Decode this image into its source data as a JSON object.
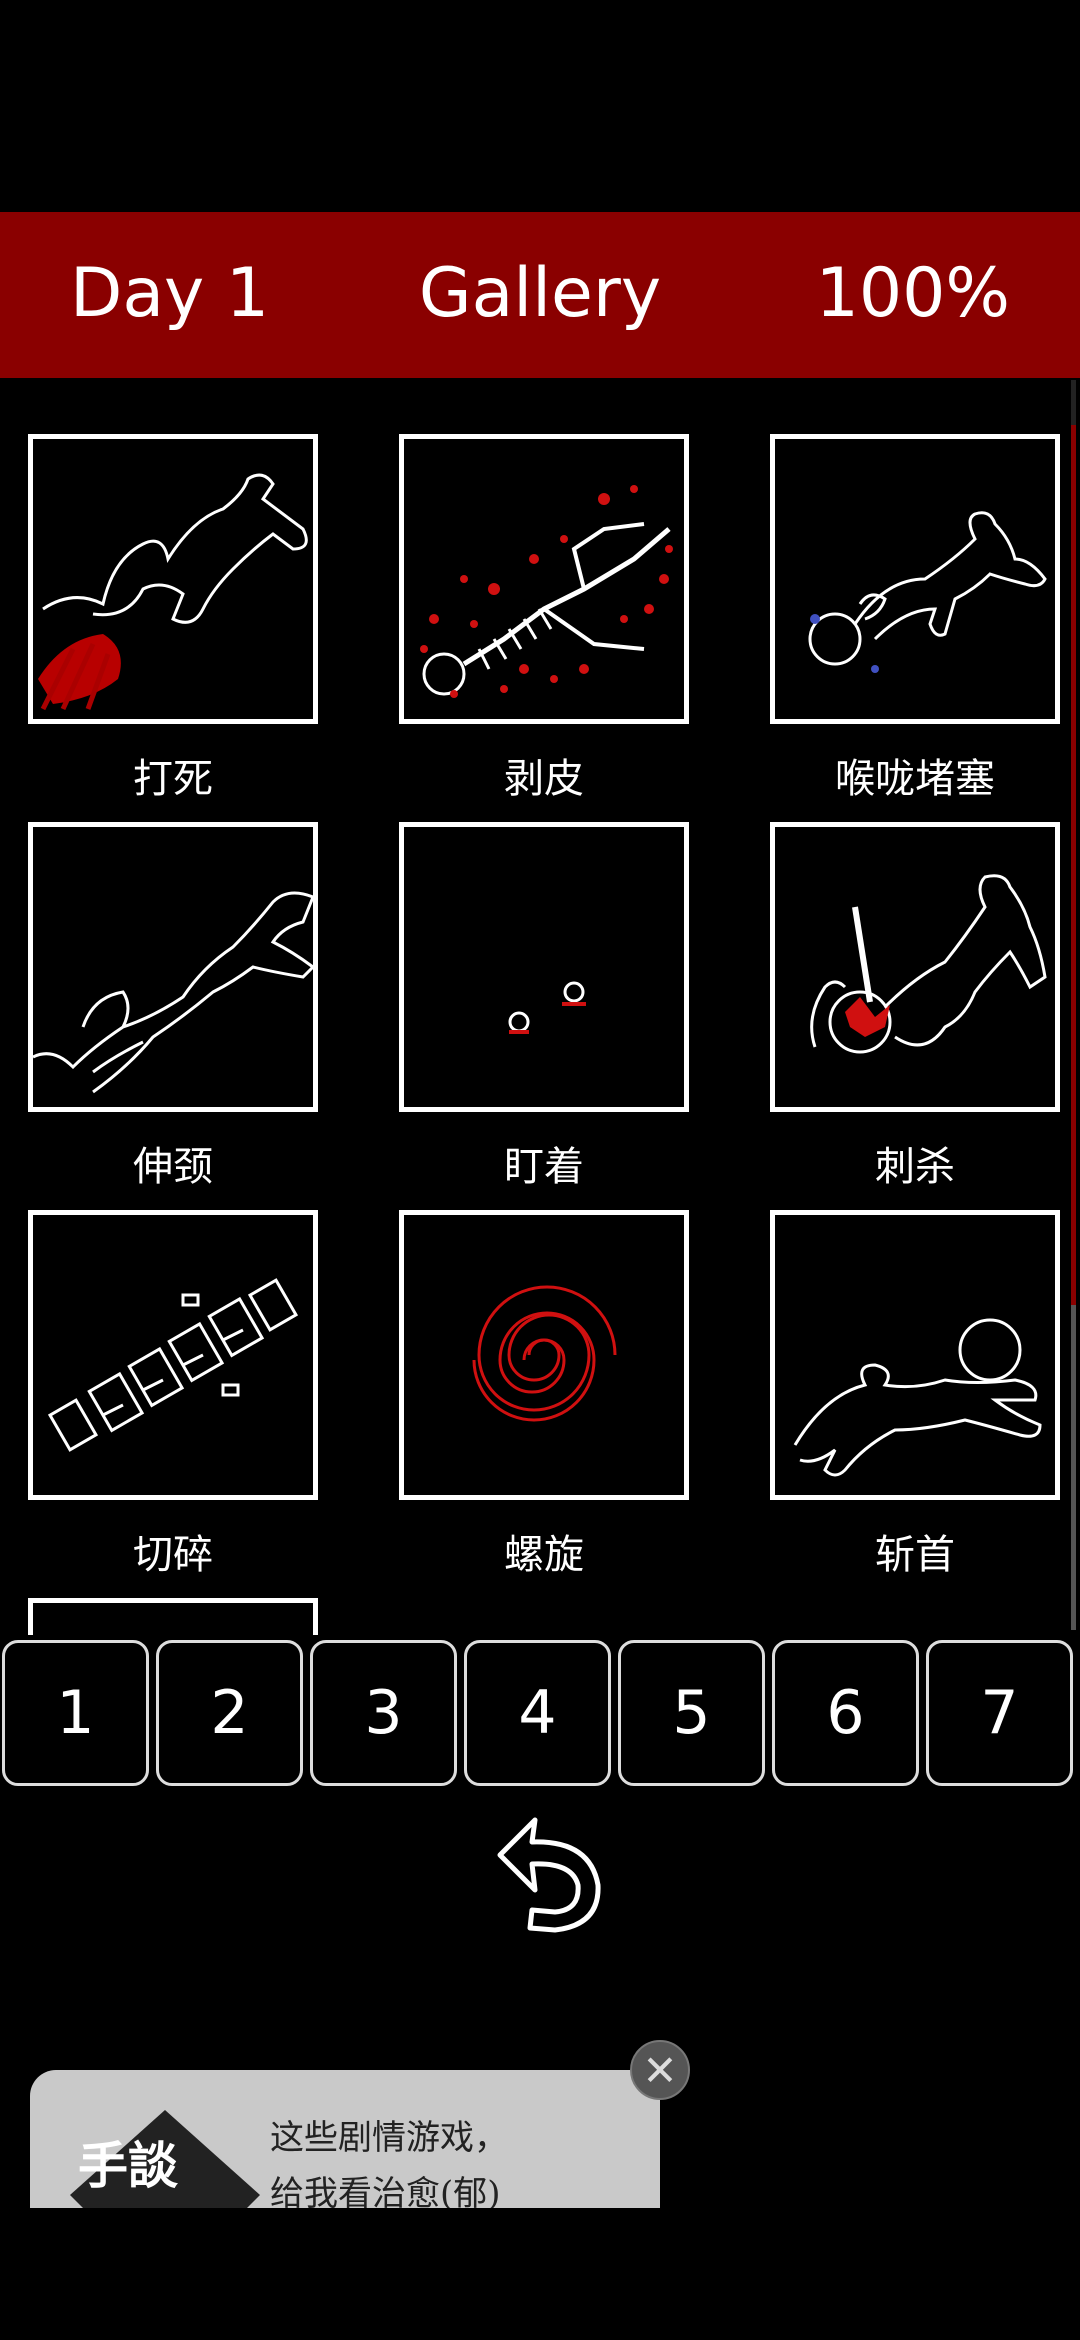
{
  "header": {
    "day": "Day 1",
    "title": "Gallery",
    "progress": "100%"
  },
  "gallery": {
    "items": [
      {
        "caption": "打死",
        "thumb": "outline-body-blood"
      },
      {
        "caption": "剥皮",
        "thumb": "skeleton-blood"
      },
      {
        "caption": "喉咙堵塞",
        "thumb": "outline-body-choke"
      },
      {
        "caption": "伸颈",
        "thumb": "outline-stretched"
      },
      {
        "caption": "盯着",
        "thumb": "eyes-dark"
      },
      {
        "caption": "刺杀",
        "thumb": "outline-stabbed"
      },
      {
        "caption": "切碎",
        "thumb": "outline-chopped"
      },
      {
        "caption": "螺旋",
        "thumb": "red-spiral"
      },
      {
        "caption": "斩首",
        "thumb": "outline-beheaded"
      },
      {
        "caption": "",
        "thumb": "partial"
      }
    ]
  },
  "pages": [
    "1",
    "2",
    "3",
    "4",
    "5",
    "6",
    "7"
  ],
  "back": {
    "icon": "back-arrow-icon"
  },
  "ad": {
    "logo_text": "手談",
    "line1": "这些剧情游戏，",
    "line2": "给我看治愈(郁)",
    "close": "✕"
  },
  "colors": {
    "header_bg": "#8a0000",
    "blood": "#d01010",
    "outline": "#ffffff"
  }
}
